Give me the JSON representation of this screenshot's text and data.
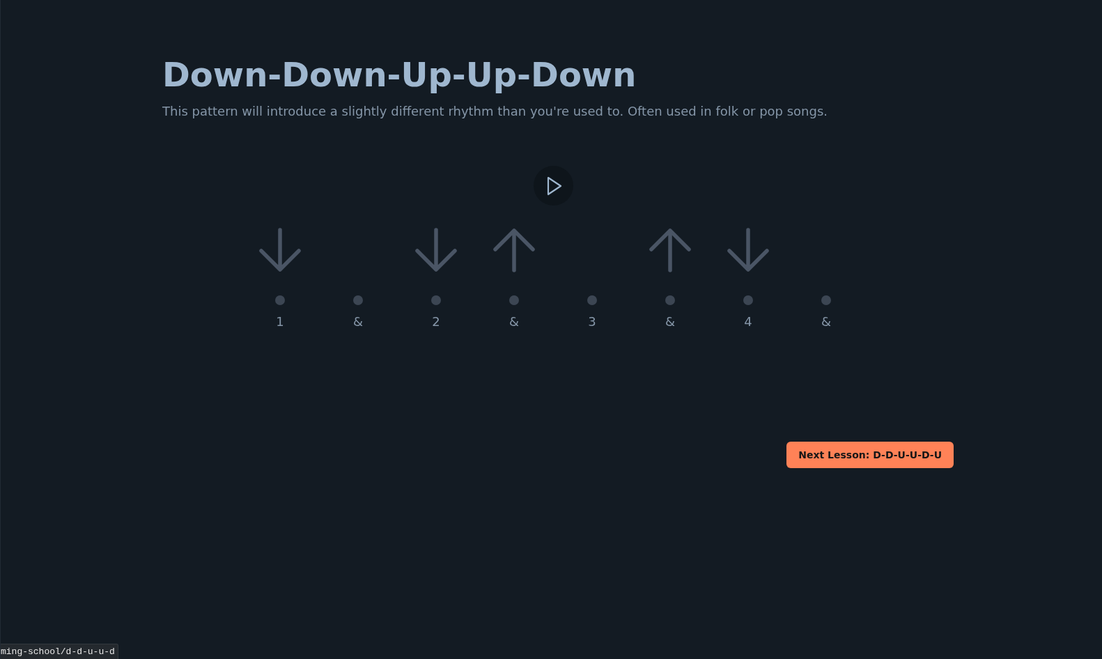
{
  "title": "Down-Down-Up-Up-Down",
  "description": "This pattern will introduce a slightly different rhythm than you're used to. Often used in folk or pop songs.",
  "player": {
    "playing": false
  },
  "beats": [
    {
      "label": "1",
      "kind": "down"
    },
    {
      "label": "&",
      "kind": "rest"
    },
    {
      "label": "2",
      "kind": "down"
    },
    {
      "label": "&",
      "kind": "up"
    },
    {
      "label": "3",
      "kind": "rest"
    },
    {
      "label": "&",
      "kind": "up"
    },
    {
      "label": "4",
      "kind": "down"
    },
    {
      "label": "&",
      "kind": "rest"
    }
  ],
  "next_lesson_button": "Next Lesson: D-D-U-U-D-U",
  "status_url": "ming-school/d-d-u-u-d"
}
